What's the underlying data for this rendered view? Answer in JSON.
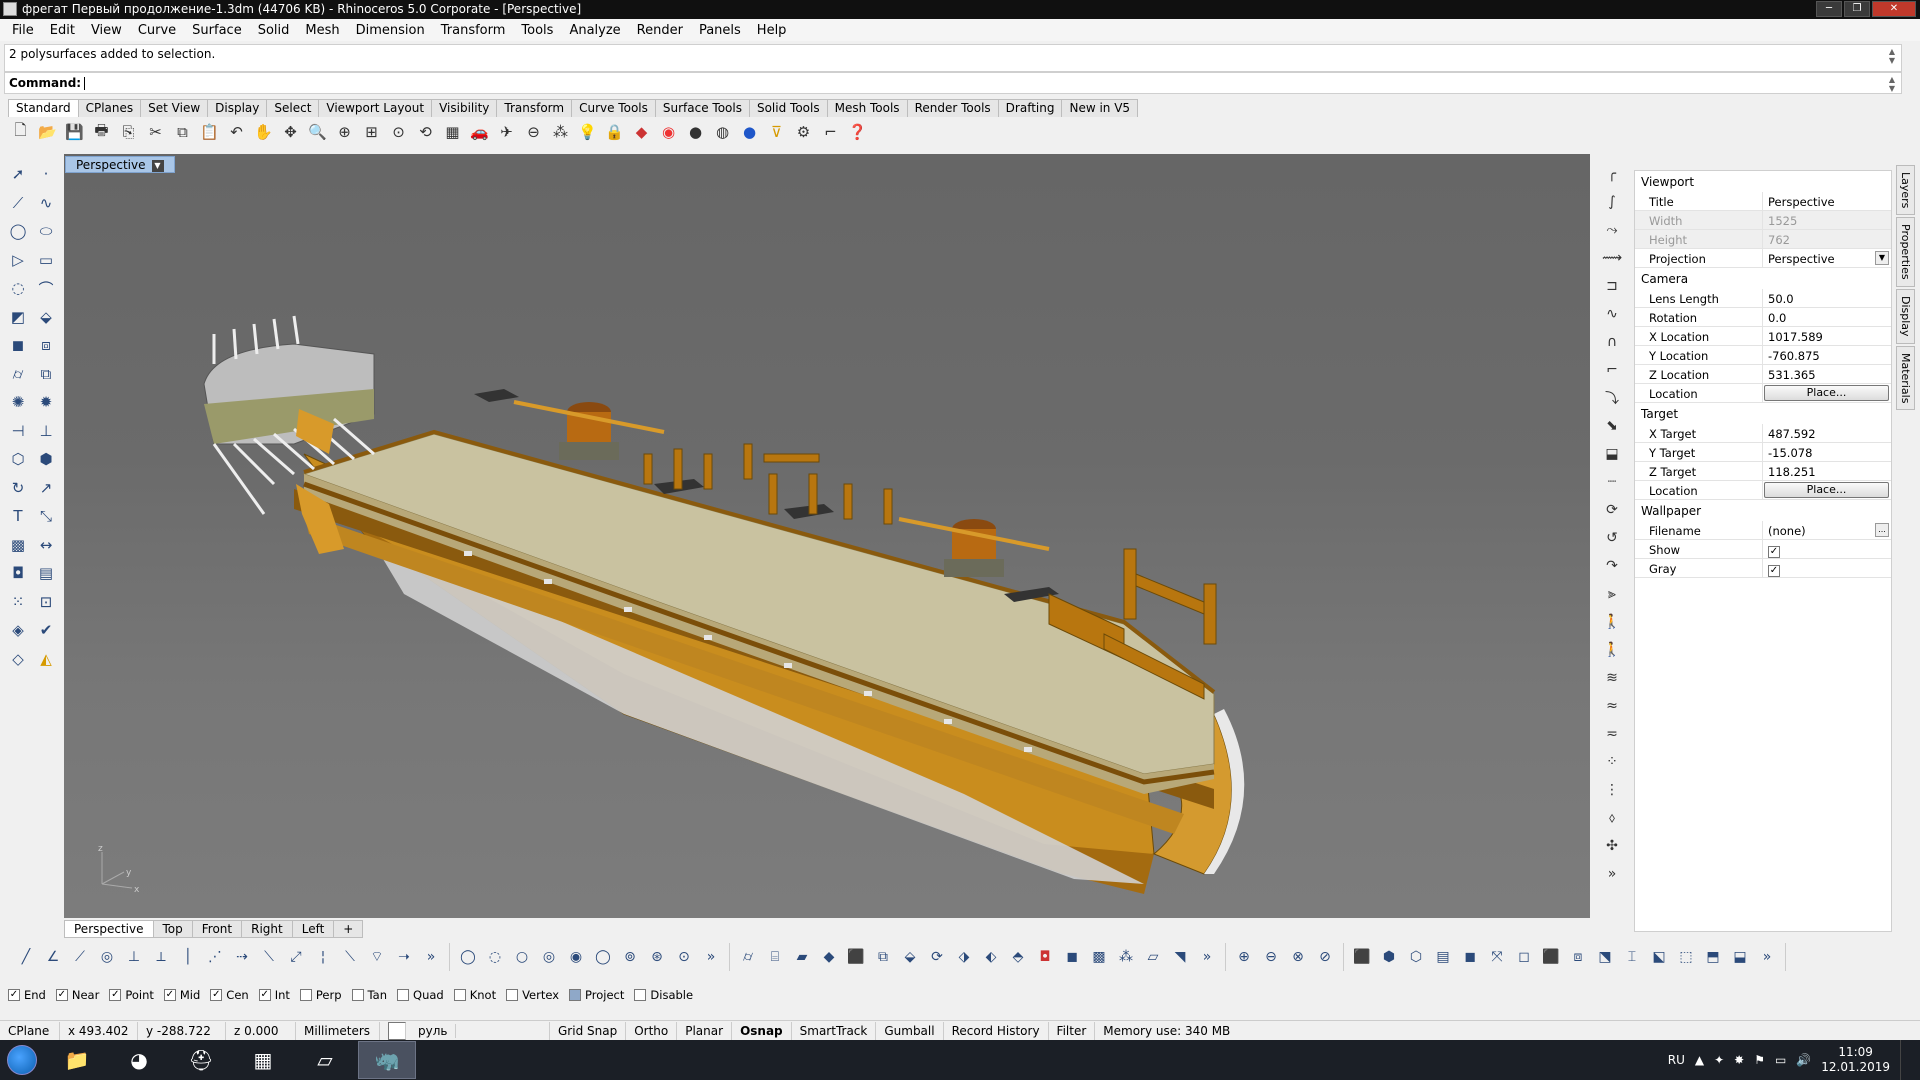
{
  "window": {
    "title": "фрегат Первый продолжение-1.3dm (44706 KB) - Rhinoceros  5.0 Corporate - [Perspective]"
  },
  "menu": [
    "File",
    "Edit",
    "View",
    "Curve",
    "Surface",
    "Solid",
    "Mesh",
    "Dimension",
    "Transform",
    "Tools",
    "Analyze",
    "Render",
    "Panels",
    "Help"
  ],
  "command": {
    "history": "2 polysurfaces added to selection.",
    "prompt": "Command:"
  },
  "toolbar_tabs": [
    "Standard",
    "CPlanes",
    "Set View",
    "Display",
    "Select",
    "Viewport Layout",
    "Visibility",
    "Transform",
    "Curve Tools",
    "Surface Tools",
    "Solid Tools",
    "Mesh Tools",
    "Render Tools",
    "Drafting",
    "New in V5"
  ],
  "viewport": {
    "label": "Perspective"
  },
  "viewport_tabs": [
    "Perspective",
    "Top",
    "Front",
    "Right",
    "Left",
    "+"
  ],
  "panel": {
    "viewport_section": "Viewport",
    "title_label": "Title",
    "title_value": "Perspective",
    "width_label": "Width",
    "width_value": "1525",
    "height_label": "Height",
    "height_value": "762",
    "projection_label": "Projection",
    "projection_value": "Perspective",
    "camera_section": "Camera",
    "lens_label": "Lens Length",
    "lens_value": "50.0",
    "rotation_label": "Rotation",
    "rotation_value": "0.0",
    "xloc_label": "X Location",
    "xloc_value": "1017.589",
    "yloc_label": "Y Location",
    "yloc_value": "-760.875",
    "zloc_label": "Z Location",
    "zloc_value": "531.365",
    "location_label": "Location",
    "place_label": "Place...",
    "target_section": "Target",
    "xt_label": "X Target",
    "xt_value": "487.592",
    "yt_label": "Y Target",
    "yt_value": "-15.078",
    "zt_label": "Z Target",
    "zt_value": "118.251",
    "wallpaper_section": "Wallpaper",
    "filename_label": "Filename",
    "filename_value": "(none)",
    "filename_btn": "...",
    "show_label": "Show",
    "gray_label": "Gray"
  },
  "side_tabs": [
    "Layers",
    "Properties",
    "Display",
    "Materials"
  ],
  "osnaps": [
    {
      "label": "End",
      "checked": true
    },
    {
      "label": "Near",
      "checked": true
    },
    {
      "label": "Point",
      "checked": true
    },
    {
      "label": "Mid",
      "checked": true
    },
    {
      "label": "Cen",
      "checked": true
    },
    {
      "label": "Int",
      "checked": true
    },
    {
      "label": "Perp",
      "checked": false
    },
    {
      "label": "Tan",
      "checked": false
    },
    {
      "label": "Quad",
      "checked": false
    },
    {
      "label": "Knot",
      "checked": false
    },
    {
      "label": "Vertex",
      "checked": false
    },
    {
      "label": "Project",
      "checked": false
    },
    {
      "label": "Disable",
      "checked": false
    }
  ],
  "status": {
    "cplane": "CPlane",
    "x": "x 493.402",
    "y": "y -288.722",
    "z": "z 0.000",
    "units": "Millimeters",
    "layer": "руль",
    "gridsnap": "Grid Snap",
    "ortho": "Ortho",
    "planar": "Planar",
    "osnap": "Osnap",
    "smarttrack": "SmartTrack",
    "gumball": "Gumball",
    "record": "Record History",
    "filter": "Filter",
    "memory": "Memory use: 340 MB"
  },
  "taskbar": {
    "lang": "RU",
    "time": "11:09",
    "date": "12.01.2019"
  },
  "icons": {
    "accent_hull": "#d89a2a",
    "deck": "#c9c2a0",
    "wood": "#b8760f"
  }
}
